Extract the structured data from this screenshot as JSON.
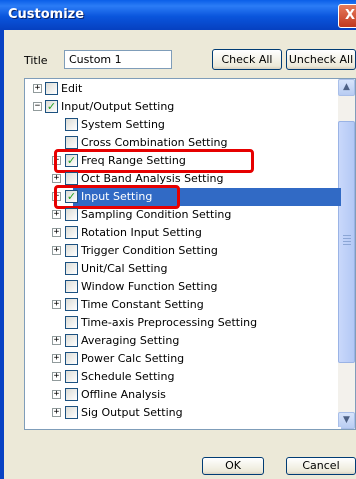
{
  "window": {
    "title": "Customize",
    "close_glyph": "X"
  },
  "form": {
    "title_label": "Title",
    "title_value": "Custom 1"
  },
  "buttons": {
    "check_all": "Check All",
    "uncheck_all": "Uncheck All",
    "ok": "OK",
    "cancel": "Cancel"
  },
  "tree": {
    "items": [
      {
        "label": "Edit",
        "level": 0,
        "expander": "+",
        "checked": false
      },
      {
        "label": "Input/Output Setting",
        "level": 0,
        "expander": "−",
        "checked": true
      },
      {
        "label": "System Setting",
        "level": 1,
        "expander": "",
        "checked": false
      },
      {
        "label": "Cross Combination Setting",
        "level": 1,
        "expander": "",
        "checked": false
      },
      {
        "label": "Freq Range Setting",
        "level": 1,
        "expander": "+",
        "checked": true,
        "highlighted": true
      },
      {
        "label": "Oct Band Analysis Setting",
        "level": 1,
        "expander": "+",
        "checked": false
      },
      {
        "label": "Input Setting",
        "level": 1,
        "expander": "+",
        "checked": true,
        "selected": true,
        "highlighted": true
      },
      {
        "label": "Sampling Condition Setting",
        "level": 1,
        "expander": "+",
        "checked": false
      },
      {
        "label": "Rotation Input Setting",
        "level": 1,
        "expander": "+",
        "checked": false
      },
      {
        "label": "Trigger Condition Setting",
        "level": 1,
        "expander": "+",
        "checked": false
      },
      {
        "label": "Unit/Cal Setting",
        "level": 1,
        "expander": "",
        "checked": false
      },
      {
        "label": "Window Function Setting",
        "level": 1,
        "expander": "",
        "checked": false
      },
      {
        "label": "Time Constant Setting",
        "level": 1,
        "expander": "+",
        "checked": false
      },
      {
        "label": "Time-axis Preprocessing Setting",
        "level": 1,
        "expander": "",
        "checked": false
      },
      {
        "label": "Averaging Setting",
        "level": 1,
        "expander": "+",
        "checked": false
      },
      {
        "label": "Power Calc Setting",
        "level": 1,
        "expander": "+",
        "checked": false
      },
      {
        "label": "Schedule Setting",
        "level": 1,
        "expander": "+",
        "checked": false
      },
      {
        "label": "Offline Analysis",
        "level": 1,
        "expander": "+",
        "checked": false
      },
      {
        "label": "Sig Output Setting",
        "level": 1,
        "expander": "+",
        "checked": false
      }
    ]
  },
  "scrollbar": {
    "up_glyph": "▲",
    "down_glyph": "▼"
  },
  "colors": {
    "selection": "#316ac5",
    "highlight_box": "#e60000",
    "titlebar": "#0a55dc",
    "check": "#21a121"
  }
}
